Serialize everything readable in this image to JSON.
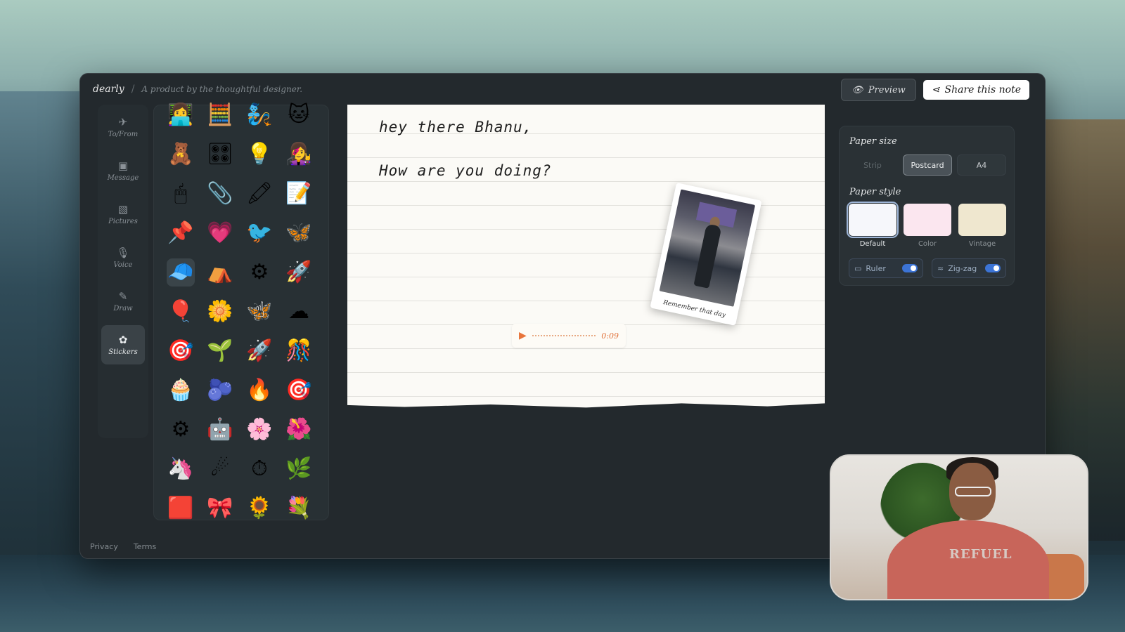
{
  "header": {
    "brand": "dearly",
    "separator": "/",
    "tagline": "A product by the thoughtful designer.",
    "preview_label": "Preview",
    "share_label": "Share this note"
  },
  "sidebar": {
    "items": [
      {
        "label": "To/From",
        "icon": "send-icon"
      },
      {
        "label": "Message",
        "icon": "message-icon"
      },
      {
        "label": "Pictures",
        "icon": "image-icon"
      },
      {
        "label": "Voice",
        "icon": "mic-icon"
      },
      {
        "label": "Draw",
        "icon": "pen-icon"
      },
      {
        "label": "Stickers",
        "icon": "sticker-icon",
        "active": true
      }
    ]
  },
  "stickers": [
    "👩‍💻",
    "🧮",
    "🧞",
    "🐱",
    "🧸",
    "🎛",
    "💡",
    "👩‍🎤",
    "🖱",
    "📎",
    "🖍",
    "📝",
    "📌",
    "💗",
    "🐦",
    "🦋",
    "🧢",
    "⛺",
    "⚙",
    "🚀",
    "🎈",
    "🌼",
    "🦋",
    "☁",
    "🎯",
    "🌱",
    "🚀",
    "🎊",
    "🧁",
    "🫐",
    "🔥",
    "🎯",
    "⚙",
    "🤖",
    "🌸",
    "🌺",
    "🦄",
    "☄",
    "⏱",
    "🌿",
    "🟥",
    "🎀",
    "🌻",
    "💐"
  ],
  "note": {
    "line1": "hey there Bhanu,",
    "line2": "How are you doing?",
    "photo_caption": "Remember that day",
    "voice_time": "0:09"
  },
  "settings": {
    "paper_size_label": "Paper size",
    "sizes": [
      "Strip",
      "Postcard",
      "A4"
    ],
    "selected_size": "Postcard",
    "paper_style_label": "Paper style",
    "styles": [
      {
        "label": "Default",
        "color": "#f6f7fb",
        "selected": true
      },
      {
        "label": "Color",
        "color": "#fbe6ef",
        "selected": false
      },
      {
        "label": "Vintage",
        "color": "#efe7cf",
        "selected": false
      }
    ],
    "ruler_label": "Ruler",
    "ruler_on": true,
    "zigzag_label": "Zig-zag",
    "zigzag_on": true
  },
  "footer": {
    "privacy": "Privacy",
    "terms": "Terms"
  },
  "webcam": {
    "shirt_text": "REFUEL"
  }
}
